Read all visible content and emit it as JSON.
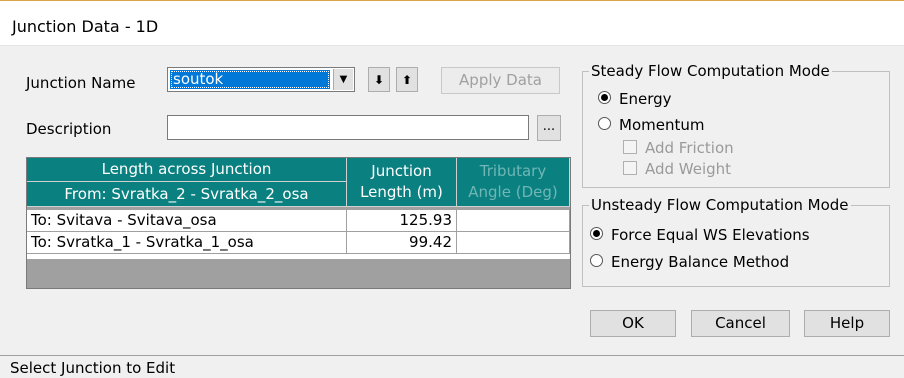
{
  "window": {
    "title": "Junction Data - 1D"
  },
  "junction": {
    "name_label": "Junction Name",
    "name_value": "soutok",
    "down_arrow": "⬇",
    "up_arrow": "⬆",
    "apply_label": "Apply Data",
    "description_label": "Description",
    "description_value": "",
    "ellipsis": "..."
  },
  "table": {
    "header_length_across": "Length across Junction",
    "header_from": "From: Svratka_2 - Svratka_2_osa",
    "header_junction_length": "Junction Length (m)",
    "header_tributary": "Tributary Angle (Deg)",
    "rows": [
      {
        "to": "To: Svitava - Svitava_osa",
        "length": "125.93",
        "angle": ""
      },
      {
        "to": "To: Svratka_1 - Svratka_1_osa",
        "length": "99.42",
        "angle": ""
      }
    ]
  },
  "steady": {
    "legend": "Steady Flow Computation Mode",
    "energy": "Energy",
    "momentum": "Momentum",
    "add_friction": "Add Friction",
    "add_weight": "Add Weight",
    "selected": "energy"
  },
  "unsteady": {
    "legend": "Unsteady Flow Computation Mode",
    "force_equal": "Force Equal WS Elevations",
    "energy_balance": "Energy Balance Method",
    "selected": "force_equal"
  },
  "buttons": {
    "ok": "OK",
    "cancel": "Cancel",
    "help": "Help"
  },
  "status": {
    "text": "Select Junction to Edit"
  }
}
